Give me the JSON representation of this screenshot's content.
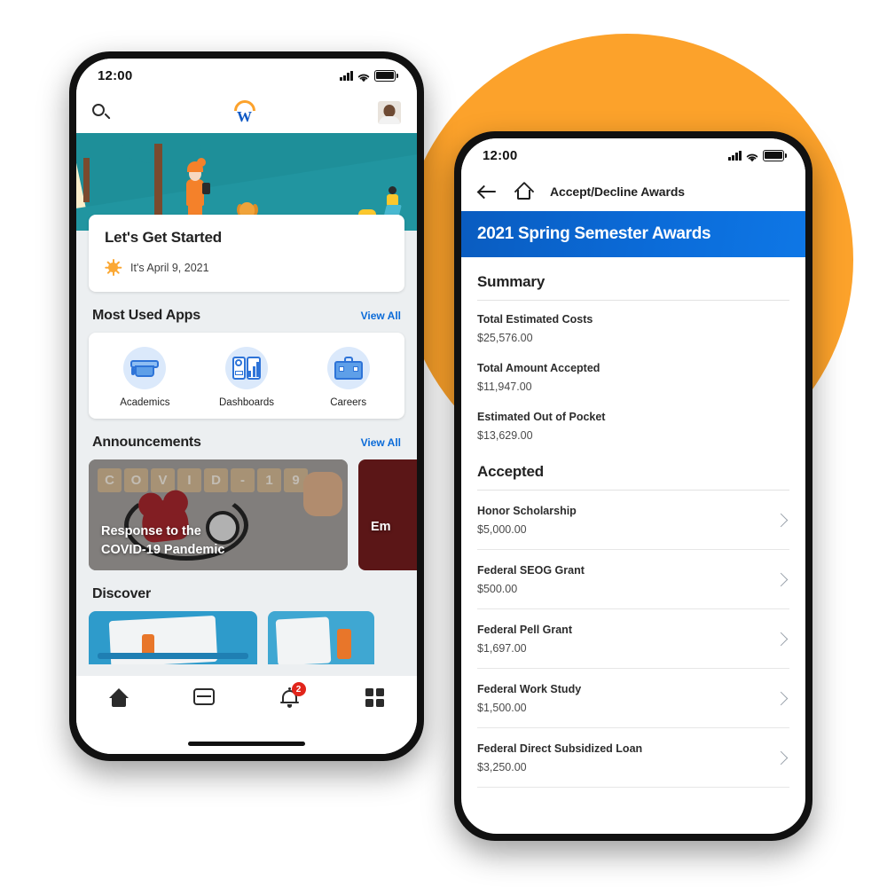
{
  "theme": {
    "orange": "#FCA22B",
    "blue": "#0B6BD8",
    "badge_red": "#E1251B",
    "link_blue": "#0B6BD8"
  },
  "phone1": {
    "status": {
      "time": "12:00",
      "signal_icon": "cellular-signal-icon",
      "wifi_icon": "wifi-icon",
      "battery_icon": "battery-full-icon"
    },
    "appbar": {
      "search_icon": "search-icon",
      "logo_icon": "workday-logo-icon",
      "logo_letter": "W",
      "avatar_icon": "user-avatar"
    },
    "hero": {
      "illustration": "hiker-sunset-illustration"
    },
    "started_card": {
      "title": "Let's Get Started",
      "sun_icon": "sun-icon",
      "date": "It's April 9, 2021"
    },
    "most_used": {
      "title": "Most Used Apps",
      "view_all": "View All",
      "apps": [
        {
          "label": "Academics",
          "icon": "graduation-cap-icon"
        },
        {
          "label": "Dashboards",
          "icon": "dashboard-chart-icon"
        },
        {
          "label": "Careers",
          "icon": "briefcase-icon"
        }
      ]
    },
    "announcements": {
      "title": "Announcements",
      "view_all": "View All",
      "cards": [
        {
          "title": "Response to the\nCOVID-19 Pandemic",
          "title_line1": "Response to the",
          "title_line2": "COVID-19 Pandemic",
          "blocks": [
            "C",
            "O",
            "V",
            "I",
            "D",
            "-",
            "1",
            "9"
          ]
        },
        {
          "title_line1": "Em",
          "title_line2": ""
        }
      ]
    },
    "discover": {
      "title": "Discover"
    },
    "tabbar": {
      "items": [
        {
          "name": "home",
          "icon": "home-icon",
          "badge": ""
        },
        {
          "name": "inbox",
          "icon": "inbox-icon",
          "badge": ""
        },
        {
          "name": "notifications",
          "icon": "bell-icon",
          "badge": "2"
        },
        {
          "name": "apps",
          "icon": "grid-apps-icon",
          "badge": ""
        }
      ]
    }
  },
  "phone2": {
    "status": {
      "time": "12:00",
      "signal_icon": "cellular-signal-icon",
      "wifi_icon": "wifi-icon",
      "battery_icon": "battery-full-icon"
    },
    "nav": {
      "back_icon": "back-arrow-icon",
      "home_icon": "home-icon",
      "title": "Accept/Decline Awards"
    },
    "banner": {
      "title": "2021 Spring Semester Awards"
    },
    "summary": {
      "heading": "Summary",
      "items": [
        {
          "label": "Total Estimated Costs",
          "value": "$25,576.00"
        },
        {
          "label": "Total Amount Accepted",
          "value": "$11,947.00"
        },
        {
          "label": "Estimated Out of Pocket",
          "value": "$13,629.00"
        }
      ]
    },
    "accepted": {
      "heading": "Accepted",
      "items": [
        {
          "name": "Honor Scholarship",
          "amount": "$5,000.00",
          "chevron": "chevron-right-icon"
        },
        {
          "name": "Federal SEOG Grant",
          "amount": "$500.00",
          "chevron": "chevron-right-icon"
        },
        {
          "name": "Federal Pell Grant",
          "amount": "$1,697.00",
          "chevron": "chevron-right-icon"
        },
        {
          "name": "Federal Work Study",
          "amount": "$1,500.00",
          "chevron": "chevron-right-icon"
        },
        {
          "name": "Federal Direct Subsidized Loan",
          "amount": "$3,250.00",
          "chevron": "chevron-right-icon"
        }
      ]
    }
  }
}
